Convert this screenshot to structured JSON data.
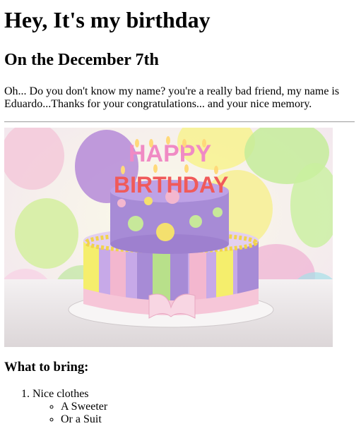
{
  "heading": "Hey, It's my birthday",
  "subheading": "On the December 7th",
  "intro": "Oh... Do you don't know my name? you're a really bad friend, my name is Eduardo...Thanks for your congratulations... and your nice memory.",
  "image": {
    "cake_text_top": "HAPPY",
    "cake_text_bottom": "BIRTHDAY"
  },
  "bring_heading": "What to bring:",
  "bring_list": {
    "item1": "Nice clothes",
    "sub1": "A Sweeter",
    "sub2": "Or a Suit"
  },
  "colors": {
    "hr": "#a8a8a8",
    "cake_purple": "#a78bd6",
    "cake_pink": "#f3b7cf",
    "ribbon_pink": "#f6c6d8"
  }
}
